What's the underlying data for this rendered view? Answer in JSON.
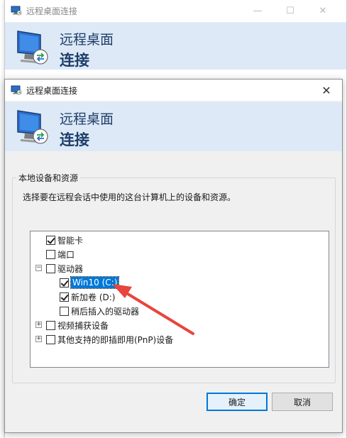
{
  "background_window": {
    "title": "远程桌面连接",
    "banner_line1": "远程桌面",
    "banner_line2": "连接",
    "minimize_glyph": "—",
    "maximize_glyph": "☐",
    "close_glyph": "✕"
  },
  "dialog": {
    "title": "远程桌面连接",
    "banner_line1": "远程桌面",
    "banner_line2": "连接",
    "close_glyph": "✕",
    "group_label": "本地设备和资源",
    "group_description": "选择要在远程会话中使用的这台计算机上的设备和资源。",
    "tree": [
      {
        "label": "智能卡",
        "checked": true,
        "expander": null,
        "level": 0
      },
      {
        "label": "端口",
        "checked": false,
        "expander": null,
        "level": 0
      },
      {
        "label": "驱动器",
        "checked": false,
        "expander": "−",
        "level": 0
      },
      {
        "label": "Win10 (C:)",
        "checked": true,
        "expander": null,
        "level": 1,
        "selected": true
      },
      {
        "label": "新加卷 (D:)",
        "checked": true,
        "expander": null,
        "level": 1
      },
      {
        "label": "稍后插入的驱动器",
        "checked": false,
        "expander": null,
        "level": 1
      },
      {
        "label": "视频捕获设备",
        "checked": false,
        "expander": "+",
        "level": 0
      },
      {
        "label": "其他支持的即插即用(PnP)设备",
        "checked": false,
        "expander": "+",
        "level": 0
      }
    ],
    "ok_label": "确定",
    "cancel_label": "取消"
  },
  "colors": {
    "banner_bg": "#dde9f6",
    "banner_text": "#1e3e6a",
    "selection": "#0078d7",
    "annotation_arrow": "#e8453c"
  },
  "icons": {
    "app": "remote-desktop-icon",
    "annotation": "red-arrow-annotation"
  }
}
